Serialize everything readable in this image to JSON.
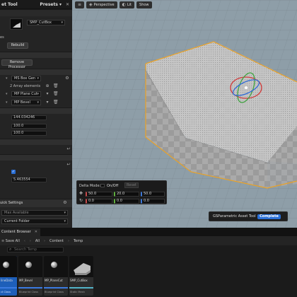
{
  "left_panel": {
    "title": "et Tool",
    "presets": "Presets",
    "mesh_asset": "SMP_CutBox",
    "side_label": "es",
    "rebuild": "Rebuild",
    "remove_processor": "Remove Processor",
    "proc1": "MS Box Gen",
    "array_label": "2 Array elements",
    "proc2": "MP Plane Cut",
    "proc3": "MP Bevel",
    "val1": "144.034246",
    "val2": "100.0",
    "val3": "100.0",
    "checkbox_mark": "✓",
    "val4": "5.463554",
    "quick_settings": "uick Settings",
    "max_available": "Max Available",
    "current_folder": "Current Folder"
  },
  "viewport": {
    "perspective": "Perspective",
    "lit": "Lit",
    "show": "Show",
    "delta_mode": "Delta Mode:",
    "on_off": "On/Off",
    "reset": "Reset",
    "loc": [
      "50.0",
      "20.0",
      "50.0"
    ],
    "rot": [
      "0.0",
      "0.0",
      "0.0"
    ],
    "toast_text": "GSParametric Asset Tool",
    "toast_status": "Complete",
    "colors": {
      "sky": "#8e9ea8",
      "grid": "#7c8a93",
      "selection": "#e9a227",
      "accent": "#2a6fd6"
    }
  },
  "content_browser": {
    "tab": "Content Browser",
    "save_all": "Save All",
    "crumb_all": "All",
    "crumb_content": "Content",
    "crumb_temp": "Temp",
    "search_placeholder": "Search Temp",
    "assets": [
      {
        "name": "lineData",
        "type": "ct Class",
        "icon": "sphere-icon"
      },
      {
        "name": "MP_Bevel",
        "type": "Blueprint Class",
        "icon": "sphere-icon"
      },
      {
        "name": "MP_PlaneCut",
        "type": "Blueprint Class",
        "icon": "sphere-icon"
      },
      {
        "name": "SMP_CutBox",
        "type": "Static Mesh",
        "icon": "mesh-icon"
      }
    ]
  }
}
